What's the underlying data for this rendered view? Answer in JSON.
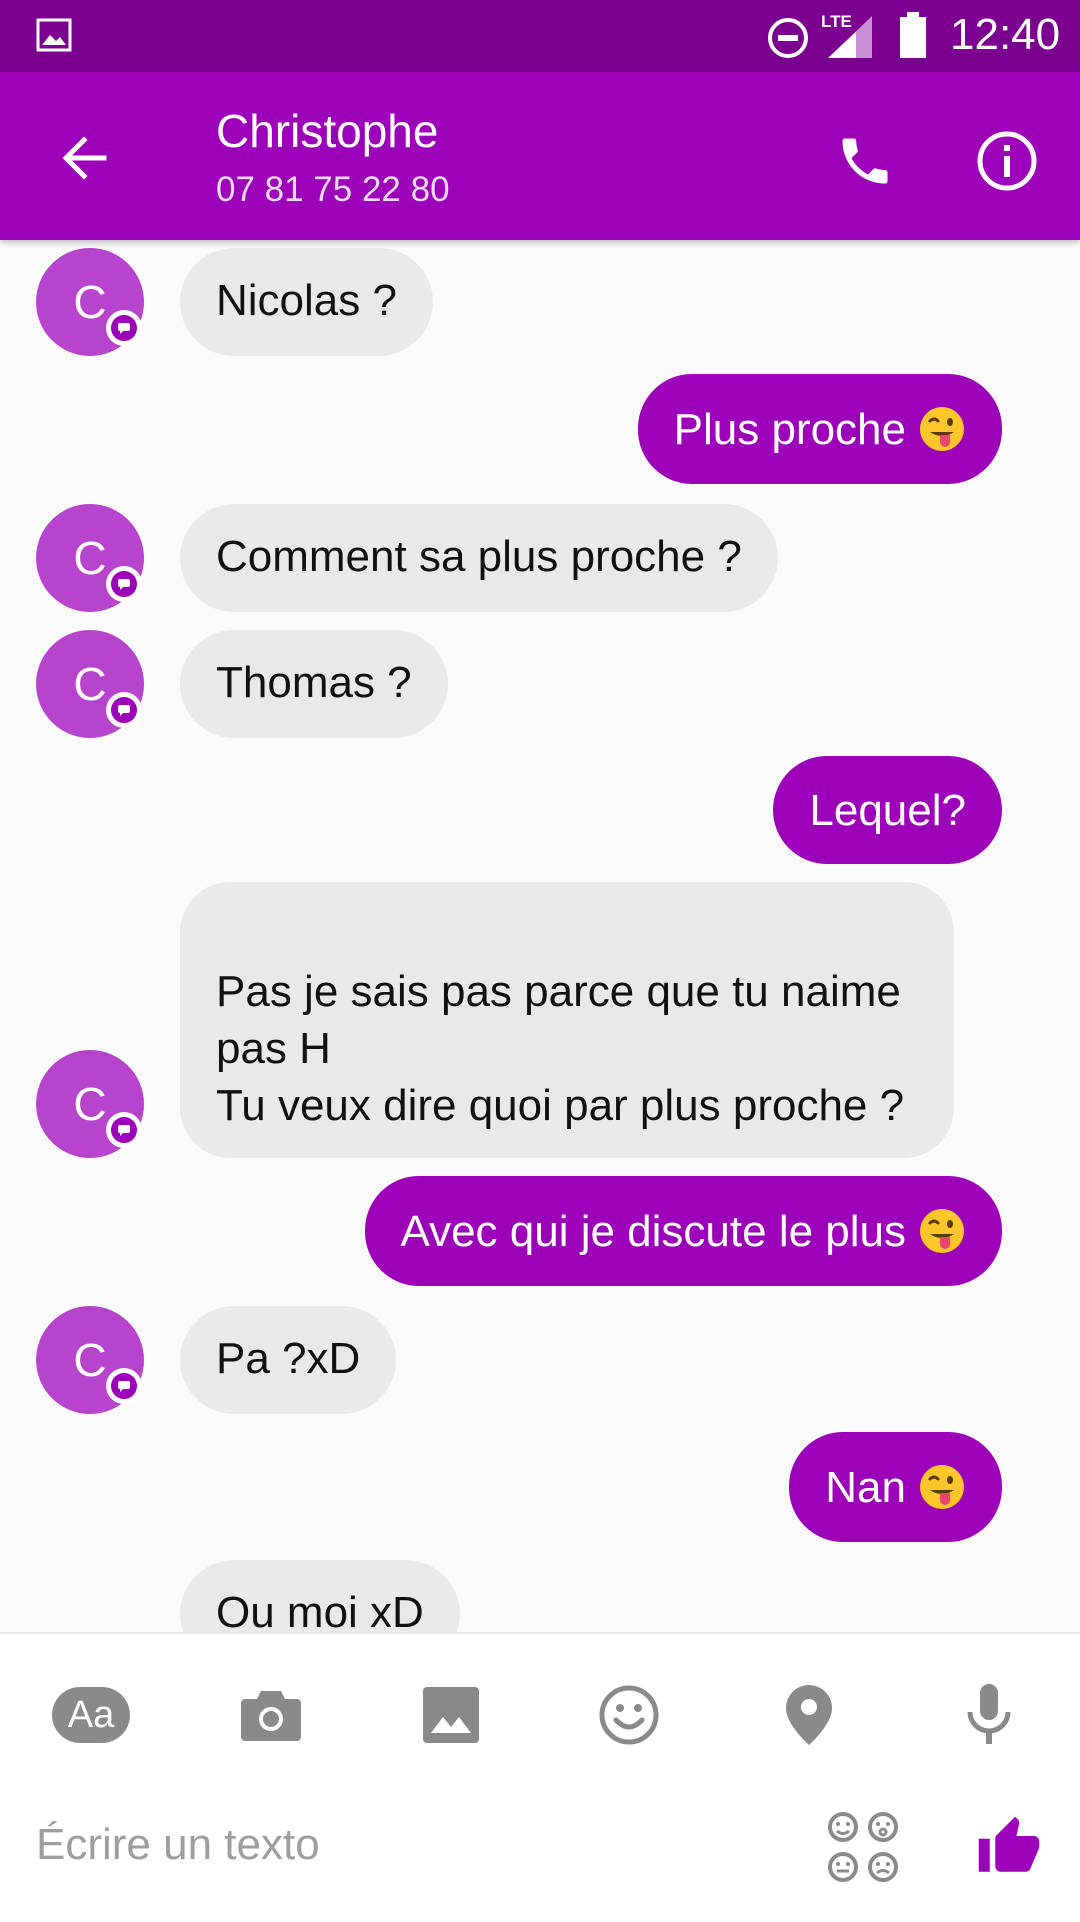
{
  "status_bar": {
    "network_label": "LTE",
    "time": "12:40"
  },
  "header": {
    "contact_name": "Christophe",
    "contact_phone": "07 81 75 22 80",
    "avatar_letter": "C"
  },
  "messages": [
    {
      "direction": "in",
      "text": "Nicolas ?"
    },
    {
      "direction": "out",
      "text": "Plus proche",
      "emoji": "face-with-tongue"
    },
    {
      "direction": "in",
      "text": "Comment sa plus proche ?"
    },
    {
      "direction": "in",
      "text": "Thomas ?"
    },
    {
      "direction": "out",
      "text": "Lequel?"
    },
    {
      "direction": "in",
      "text": "Pas je sais pas parce que tu naime pas H\nTu veux dire quoi par plus proche ?"
    },
    {
      "direction": "out",
      "text": "Avec qui je discute le plus",
      "emoji": "face-with-tongue"
    },
    {
      "direction": "in",
      "text": "Pa ?xD"
    },
    {
      "direction": "out",
      "text": "Nan",
      "emoji": "face-with-tongue"
    },
    {
      "direction": "in",
      "text": "Ou moi xD"
    }
  ],
  "composer": {
    "text_format_label": "Aa",
    "placeholder": "Écrire un texto",
    "tools": [
      "text-format-icon",
      "camera-icon",
      "gallery-icon",
      "emoji-icon",
      "location-icon",
      "microphone-icon"
    ]
  },
  "colors": {
    "status_bar": "#7b0090",
    "accent": "#9c00b8",
    "avatar": "#b744cc",
    "incoming_bubble": "#e9e9e9",
    "icon_gray": "#8a8a8a"
  }
}
